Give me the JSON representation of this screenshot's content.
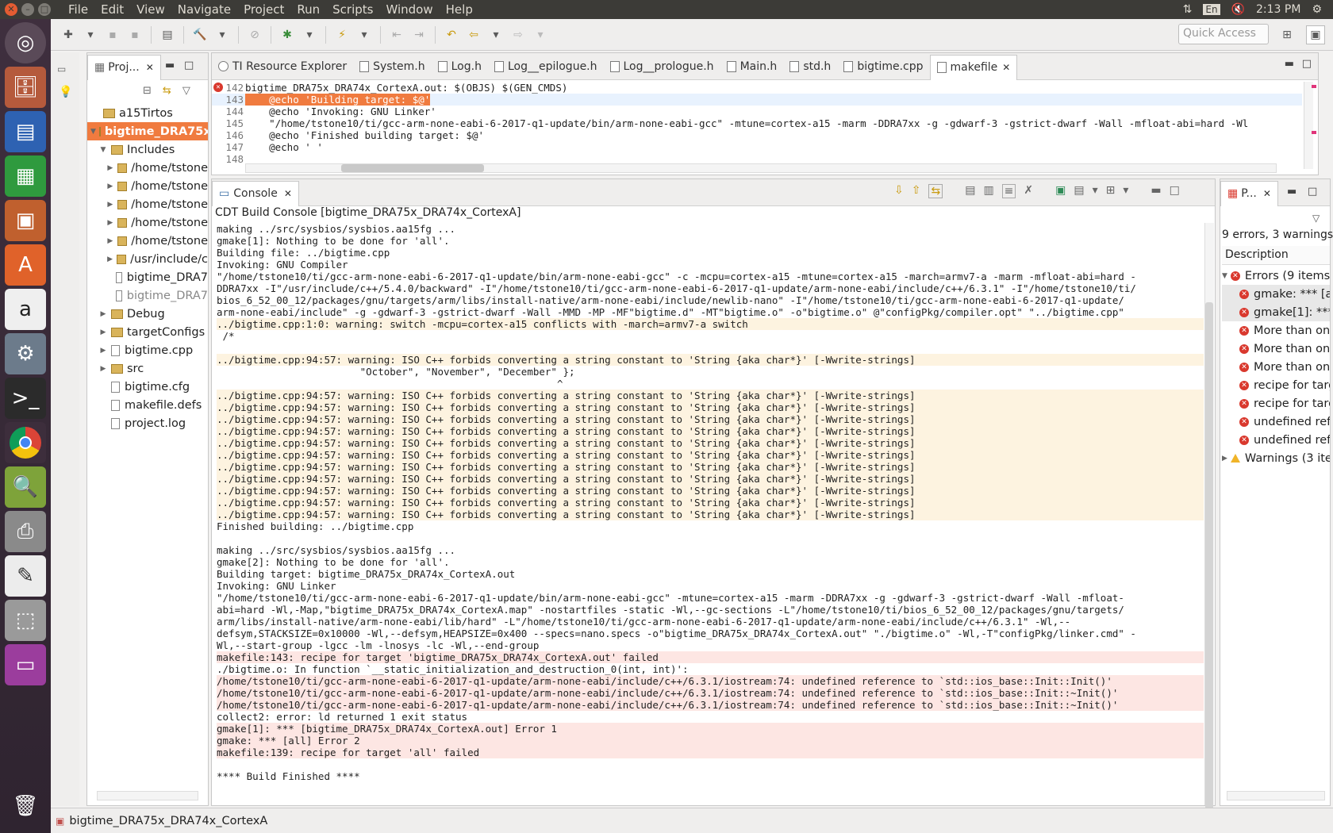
{
  "menubar": {
    "items": [
      "File",
      "Edit",
      "View",
      "Navigate",
      "Project",
      "Run",
      "Scripts",
      "Window",
      "Help"
    ],
    "lang": "En",
    "clock": "2:13 PM"
  },
  "toolbar": {
    "quick_access": "Quick Access"
  },
  "project_explorer": {
    "tab_label": "Proj...",
    "items": [
      {
        "label": "a15Tirtos",
        "level": 0,
        "twisty": ""
      },
      {
        "label": "bigtime_DRA75x",
        "level": 0,
        "twisty": "▼"
      },
      {
        "label": "Includes",
        "level": 1,
        "twisty": "▼"
      },
      {
        "label": "/home/tstone",
        "level": 2,
        "twisty": "▶"
      },
      {
        "label": "/home/tstone",
        "level": 2,
        "twisty": "▶"
      },
      {
        "label": "/home/tstone",
        "level": 2,
        "twisty": "▶"
      },
      {
        "label": "/home/tstone",
        "level": 2,
        "twisty": "▶"
      },
      {
        "label": "/home/tstone",
        "level": 2,
        "twisty": "▶"
      },
      {
        "label": "/usr/include/c",
        "level": 2,
        "twisty": "▶"
      },
      {
        "label": "bigtime_DRA7",
        "level": 2,
        "twisty": ""
      },
      {
        "label": "bigtime_DRA7",
        "level": 2,
        "twisty": ""
      },
      {
        "label": "Debug",
        "level": 1,
        "twisty": "▶"
      },
      {
        "label": "targetConfigs",
        "level": 1,
        "twisty": "▶"
      },
      {
        "label": "bigtime.cpp",
        "level": 1,
        "twisty": "▶"
      },
      {
        "label": "src",
        "level": 1,
        "twisty": "▶"
      },
      {
        "label": "bigtime.cfg",
        "level": 1,
        "twisty": ""
      },
      {
        "label": "makefile.defs",
        "level": 1,
        "twisty": ""
      },
      {
        "label": "project.log",
        "level": 1,
        "twisty": ""
      }
    ]
  },
  "editor": {
    "tabs": [
      "TI Resource Explorer",
      "System.h",
      "Log.h",
      "Log__epilogue.h",
      "Log__prologue.h",
      "Main.h",
      "std.h",
      "bigtime.cpp",
      "makefile"
    ],
    "active_tab": "makefile",
    "lines": [
      {
        "num": "142",
        "text": "bigtime_DRA75x_DRA74x_CortexA.out: $(OBJS) $(GEN_CMDS)"
      },
      {
        "num": "143",
        "text": "\t@echo 'Building target: $@'"
      },
      {
        "num": "144",
        "text": "\t@echo 'Invoking: GNU Linker'"
      },
      {
        "num": "145",
        "text": "\t\"/home/tstone10/ti/gcc-arm-none-eabi-6-2017-q1-update/bin/arm-none-eabi-gcc\" -mtune=cortex-a15 -marm -DDRA7xx -g -gdwarf-3 -gstrict-dwarf -Wall -mfloat-abi=hard -Wl"
      },
      {
        "num": "146",
        "text": "\t@echo 'Finished building target: $@'"
      },
      {
        "num": "147",
        "text": "\t@echo ' '"
      },
      {
        "num": "148",
        "text": ""
      }
    ]
  },
  "console": {
    "tab_label": "Console",
    "header": "CDT Build Console [bigtime_DRA75x_DRA74x_CortexA]",
    "lines": [
      {
        "t": "making ../src/sysbios/sysbios.aa15fg ...",
        "k": ""
      },
      {
        "t": "gmake[1]: Nothing to be done for 'all'.",
        "k": ""
      },
      {
        "t": "Building file: ../bigtime.cpp",
        "k": ""
      },
      {
        "t": "Invoking: GNU Compiler",
        "k": ""
      },
      {
        "t": "\"/home/tstone10/ti/gcc-arm-none-eabi-6-2017-q1-update/bin/arm-none-eabi-gcc\" -c -mcpu=cortex-a15 -mtune=cortex-a15 -march=armv7-a -marm -mfloat-abi=hard -",
        "k": ""
      },
      {
        "t": "DDRA7xx -I\"/usr/include/c++/5.4.0/backward\" -I\"/home/tstone10/ti/gcc-arm-none-eabi-6-2017-q1-update/arm-none-eabi/include/c++/6.3.1\" -I\"/home/tstone10/ti/",
        "k": ""
      },
      {
        "t": "bios_6_52_00_12/packages/gnu/targets/arm/libs/install-native/arm-none-eabi/include/newlib-nano\" -I\"/home/tstone10/ti/gcc-arm-none-eabi-6-2017-q1-update/",
        "k": ""
      },
      {
        "t": "arm-none-eabi/include\" -g -gdwarf-3 -gstrict-dwarf -Wall -MMD -MP -MF\"bigtime.d\" -MT\"bigtime.o\" -o\"bigtime.o\" @\"configPkg/compiler.opt\" \"../bigtime.cpp\"",
        "k": ""
      },
      {
        "t": "../bigtime.cpp:1:0: warning: switch -mcpu=cortex-a15 conflicts with -march=armv7-a switch",
        "k": "warn"
      },
      {
        "t": " /*",
        "k": ""
      },
      {
        "t": "",
        "k": ""
      },
      {
        "t": "../bigtime.cpp:94:57: warning: ISO C++ forbids converting a string constant to 'String {aka char*}' [-Wwrite-strings]",
        "k": "warn"
      },
      {
        "t": "                        \"October\", \"November\", \"December\" };",
        "k": ""
      },
      {
        "t": "                                                         ^",
        "k": ""
      },
      {
        "t": "../bigtime.cpp:94:57: warning: ISO C++ forbids converting a string constant to 'String {aka char*}' [-Wwrite-strings]",
        "k": "warn"
      },
      {
        "t": "../bigtime.cpp:94:57: warning: ISO C++ forbids converting a string constant to 'String {aka char*}' [-Wwrite-strings]",
        "k": "warn"
      },
      {
        "t": "../bigtime.cpp:94:57: warning: ISO C++ forbids converting a string constant to 'String {aka char*}' [-Wwrite-strings]",
        "k": "warn"
      },
      {
        "t": "../bigtime.cpp:94:57: warning: ISO C++ forbids converting a string constant to 'String {aka char*}' [-Wwrite-strings]",
        "k": "warn"
      },
      {
        "t": "../bigtime.cpp:94:57: warning: ISO C++ forbids converting a string constant to 'String {aka char*}' [-Wwrite-strings]",
        "k": "warn"
      },
      {
        "t": "../bigtime.cpp:94:57: warning: ISO C++ forbids converting a string constant to 'String {aka char*}' [-Wwrite-strings]",
        "k": "warn"
      },
      {
        "t": "../bigtime.cpp:94:57: warning: ISO C++ forbids converting a string constant to 'String {aka char*}' [-Wwrite-strings]",
        "k": "warn"
      },
      {
        "t": "../bigtime.cpp:94:57: warning: ISO C++ forbids converting a string constant to 'String {aka char*}' [-Wwrite-strings]",
        "k": "warn"
      },
      {
        "t": "../bigtime.cpp:94:57: warning: ISO C++ forbids converting a string constant to 'String {aka char*}' [-Wwrite-strings]",
        "k": "warn"
      },
      {
        "t": "../bigtime.cpp:94:57: warning: ISO C++ forbids converting a string constant to 'String {aka char*}' [-Wwrite-strings]",
        "k": "warn"
      },
      {
        "t": "../bigtime.cpp:94:57: warning: ISO C++ forbids converting a string constant to 'String {aka char*}' [-Wwrite-strings]",
        "k": "warn"
      },
      {
        "t": "Finished building: ../bigtime.cpp",
        "k": ""
      },
      {
        "t": "",
        "k": ""
      },
      {
        "t": "making ../src/sysbios/sysbios.aa15fg ...",
        "k": ""
      },
      {
        "t": "gmake[2]: Nothing to be done for 'all'.",
        "k": ""
      },
      {
        "t": "Building target: bigtime_DRA75x_DRA74x_CortexA.out",
        "k": ""
      },
      {
        "t": "Invoking: GNU Linker",
        "k": ""
      },
      {
        "t": "\"/home/tstone10/ti/gcc-arm-none-eabi-6-2017-q1-update/bin/arm-none-eabi-gcc\" -mtune=cortex-a15 -marm -DDRA7xx -g -gdwarf-3 -gstrict-dwarf -Wall -mfloat-",
        "k": ""
      },
      {
        "t": "abi=hard -Wl,-Map,\"bigtime_DRA75x_DRA74x_CortexA.map\" -nostartfiles -static -Wl,--gc-sections -L\"/home/tstone10/ti/bios_6_52_00_12/packages/gnu/targets/",
        "k": ""
      },
      {
        "t": "arm/libs/install-native/arm-none-eabi/lib/hard\" -L\"/home/tstone10/ti/gcc-arm-none-eabi-6-2017-q1-update/arm-none-eabi/include/c++/6.3.1\" -Wl,--",
        "k": ""
      },
      {
        "t": "defsym,STACKSIZE=0x10000 -Wl,--defsym,HEAPSIZE=0x400 --specs=nano.specs -o\"bigtime_DRA75x_DRA74x_CortexA.out\" \"./bigtime.o\" -Wl,-T\"configPkg/linker.cmd\" -",
        "k": ""
      },
      {
        "t": "Wl,--start-group -lgcc -lm -lnosys -lc -Wl,--end-group",
        "k": ""
      },
      {
        "t": "makefile:143: recipe for target 'bigtime_DRA75x_DRA74x_CortexA.out' failed",
        "k": "err"
      },
      {
        "t": "./bigtime.o: In function `__static_initialization_and_destruction_0(int, int)':",
        "k": ""
      },
      {
        "t": "/home/tstone10/ti/gcc-arm-none-eabi-6-2017-q1-update/arm-none-eabi/include/c++/6.3.1/iostream:74: undefined reference to `std::ios_base::Init::Init()'",
        "k": "err"
      },
      {
        "t": "/home/tstone10/ti/gcc-arm-none-eabi-6-2017-q1-update/arm-none-eabi/include/c++/6.3.1/iostream:74: undefined reference to `std::ios_base::Init::~Init()'",
        "k": "err"
      },
      {
        "t": "/home/tstone10/ti/gcc-arm-none-eabi-6-2017-q1-update/arm-none-eabi/include/c++/6.3.1/iostream:74: undefined reference to `std::ios_base::Init::~Init()'",
        "k": "err"
      },
      {
        "t": "collect2: error: ld returned 1 exit status",
        "k": ""
      },
      {
        "t": "gmake[1]: *** [bigtime_DRA75x_DRA74x_CortexA.out] Error 1",
        "k": "err"
      },
      {
        "t": "gmake: *** [all] Error 2",
        "k": "err"
      },
      {
        "t": "makefile:139: recipe for target 'all' failed",
        "k": "err"
      },
      {
        "t": "",
        "k": ""
      },
      {
        "t": "**** Build Finished ****",
        "k": ""
      }
    ]
  },
  "problems": {
    "tab_label": "P...",
    "summary": "9 errors, 3 warnings,",
    "column": "Description",
    "errors_group": "Errors (9 items)",
    "errors": [
      "gmake: *** [al",
      "gmake[1]: ***",
      "More than one",
      "More than one",
      "More than one",
      "recipe for targ",
      "recipe for targ",
      "undefined ref",
      "undefined ref"
    ],
    "warnings_group": "Warnings (3 item"
  },
  "status": {
    "text": "bigtime_DRA75x_DRA74x_CortexA"
  },
  "colors": {
    "accent": "#f07b3f",
    "error": "#d9382d",
    "warning_bg": "#fdf3e0",
    "error_bg": "#fde6e3"
  }
}
